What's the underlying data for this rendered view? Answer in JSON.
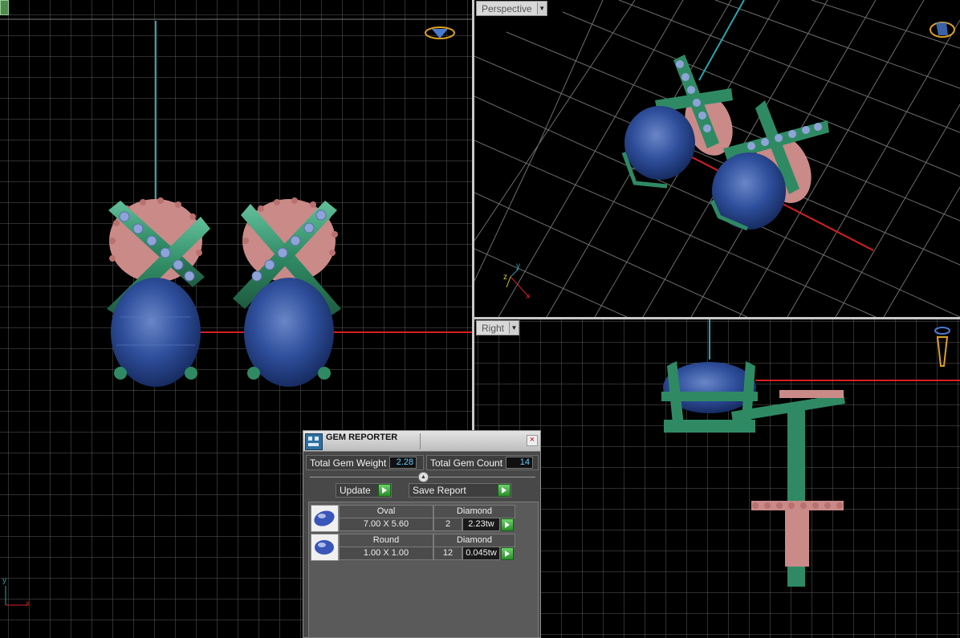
{
  "viewports": {
    "perspective": {
      "label": "Perspective"
    },
    "right": {
      "label": "Right"
    },
    "front_axes": {
      "y": "y",
      "x": "x"
    },
    "persp_axes": {
      "y": "y",
      "z": "z",
      "x": "x"
    }
  },
  "gem_reporter": {
    "title": "GEM REPORTER",
    "close": "×",
    "total_weight_label": "Total Gem Weight",
    "total_weight_value": "2.28",
    "total_count_label": "Total Gem Count",
    "total_count_value": "14",
    "update_label": "Update",
    "save_report_label": "Save Report",
    "gems": [
      {
        "shape": "Oval",
        "material": "Diamond",
        "size": "7.00 X 5.60",
        "count": "2",
        "weight": "2.23tw"
      },
      {
        "shape": "Round",
        "material": "Diamond",
        "size": "1.00 X 1.00",
        "count": "12",
        "weight": "0.045tw"
      }
    ]
  },
  "colors": {
    "grid": "#8a8a8a",
    "metal_green": "#2f8a64",
    "metal_pink": "#c98a88",
    "stone_blue": "#2d4e9a",
    "axis_red": "#d52020",
    "axis_cyan": "#2aa3b0"
  }
}
